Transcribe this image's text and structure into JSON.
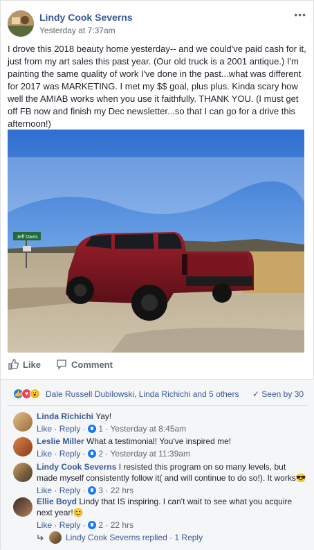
{
  "post": {
    "author": "Lindy Cook Severns",
    "timestamp": "Yesterday at 7:37am",
    "more": "•••",
    "text": "I drove this 2018 beauty home yesterday-- and we could've paid cash for it, just from my art sales this past year. (Our old truck is a 2001 antique.) I'm painting the same quality of work I've done in the past...what was different for 2017 was MARKETING. I met my $$ goal, plus plus. Kinda scary how well the AMIAB works when you use it faithfully. THANK YOU. (I must get off FB now and finish my Dec newsletter...so that I can go for a drive this afternoon!)",
    "photo_sign": "Jeff Davis"
  },
  "actions": {
    "like": "Like",
    "comment": "Comment"
  },
  "reactions": {
    "names": "Dale Russell Dubilowski, Linda Richichi and 5 others",
    "seen": "Seen by 30"
  },
  "comments": [
    {
      "name": "Linda Richichi",
      "text": "Yay!",
      "like": "Like",
      "reply": "Reply",
      "count": "1",
      "time": "Yesterday at 8:45am"
    },
    {
      "name": "Leslie Miller",
      "text": "What a testimonial! You've inspired me!",
      "like": "Like",
      "reply": "Reply",
      "count": "2",
      "time": "Yesterday at 11:39am"
    },
    {
      "name": "Lindy Cook Severns",
      "text": "I resisted this program on so many levels, but made myself consistently follow it( and will continue to do so!). It works😎",
      "like": "Like",
      "reply": "Reply",
      "count": "3",
      "time": "22 hrs"
    },
    {
      "name": "Ellie Boyd",
      "text": "Lindy that IS inspiring. I can't wait to see what you acquire next year!😊",
      "like": "Like",
      "reply": "Reply",
      "count": "2",
      "time": "22 hrs"
    }
  ],
  "replied": "Lindy Cook Severns replied · 1 Reply"
}
